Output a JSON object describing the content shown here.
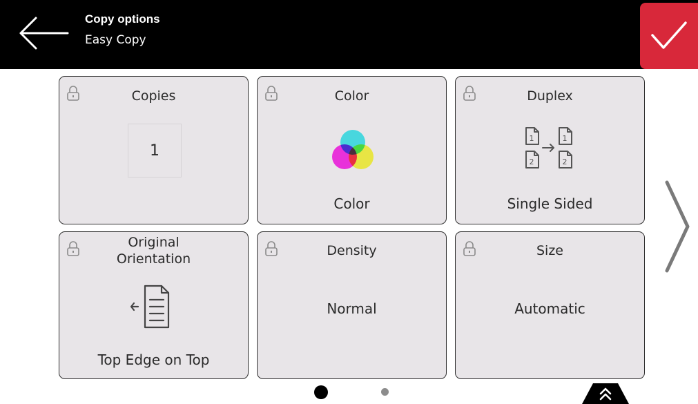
{
  "header": {
    "title": "Copy options",
    "subtitle": "Easy Copy",
    "back_icon": "arrow-left-icon",
    "confirm_icon": "checkmark-icon",
    "confirm_color": "#d8283a"
  },
  "tiles": {
    "copies": {
      "label": "Copies",
      "value": "1"
    },
    "color": {
      "label": "Color",
      "value": "Color"
    },
    "duplex": {
      "label": "Duplex",
      "value": "Single Sided"
    },
    "orientation": {
      "label_line1": "Original",
      "label_line2": "Orientation",
      "value": "Top Edge on Top"
    },
    "density": {
      "label": "Density",
      "value": "Normal"
    },
    "size": {
      "label": "Size",
      "value": "Automatic"
    }
  },
  "pagination": {
    "current": 1,
    "total": 2
  },
  "icons": {
    "lock": "lock-icon",
    "next": "chevron-right-icon",
    "expand": "double-chevron-up-icon"
  }
}
